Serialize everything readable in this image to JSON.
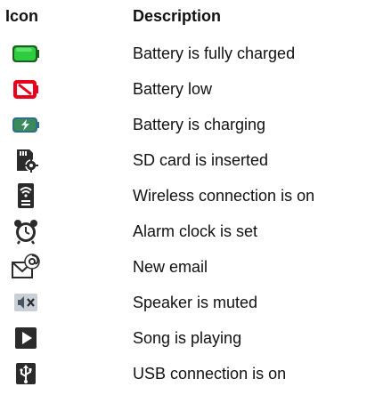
{
  "headers": {
    "icon": "Icon",
    "description": "Description"
  },
  "colors": {
    "battery_full": "#2ecc40",
    "battery_low": "#e8001c",
    "battery_charging": "#3b8a5a",
    "icon_dark": "#2b2b2b",
    "text": "#111111"
  },
  "rows": [
    {
      "icon": "battery-full-icon",
      "description": "Battery is fully charged"
    },
    {
      "icon": "battery-low-icon",
      "description": "Battery low"
    },
    {
      "icon": "battery-charging-icon",
      "description": "Battery is charging"
    },
    {
      "icon": "sd-card-icon",
      "description": "SD card is inserted"
    },
    {
      "icon": "wireless-icon",
      "description": "Wireless connection is on"
    },
    {
      "icon": "alarm-clock-icon",
      "description": "Alarm clock is set"
    },
    {
      "icon": "new-email-icon",
      "description": "New email"
    },
    {
      "icon": "speaker-muted-icon",
      "description": "Speaker is muted"
    },
    {
      "icon": "play-icon",
      "description": "Song is playing"
    },
    {
      "icon": "usb-icon",
      "description": "USB connection is on"
    }
  ]
}
